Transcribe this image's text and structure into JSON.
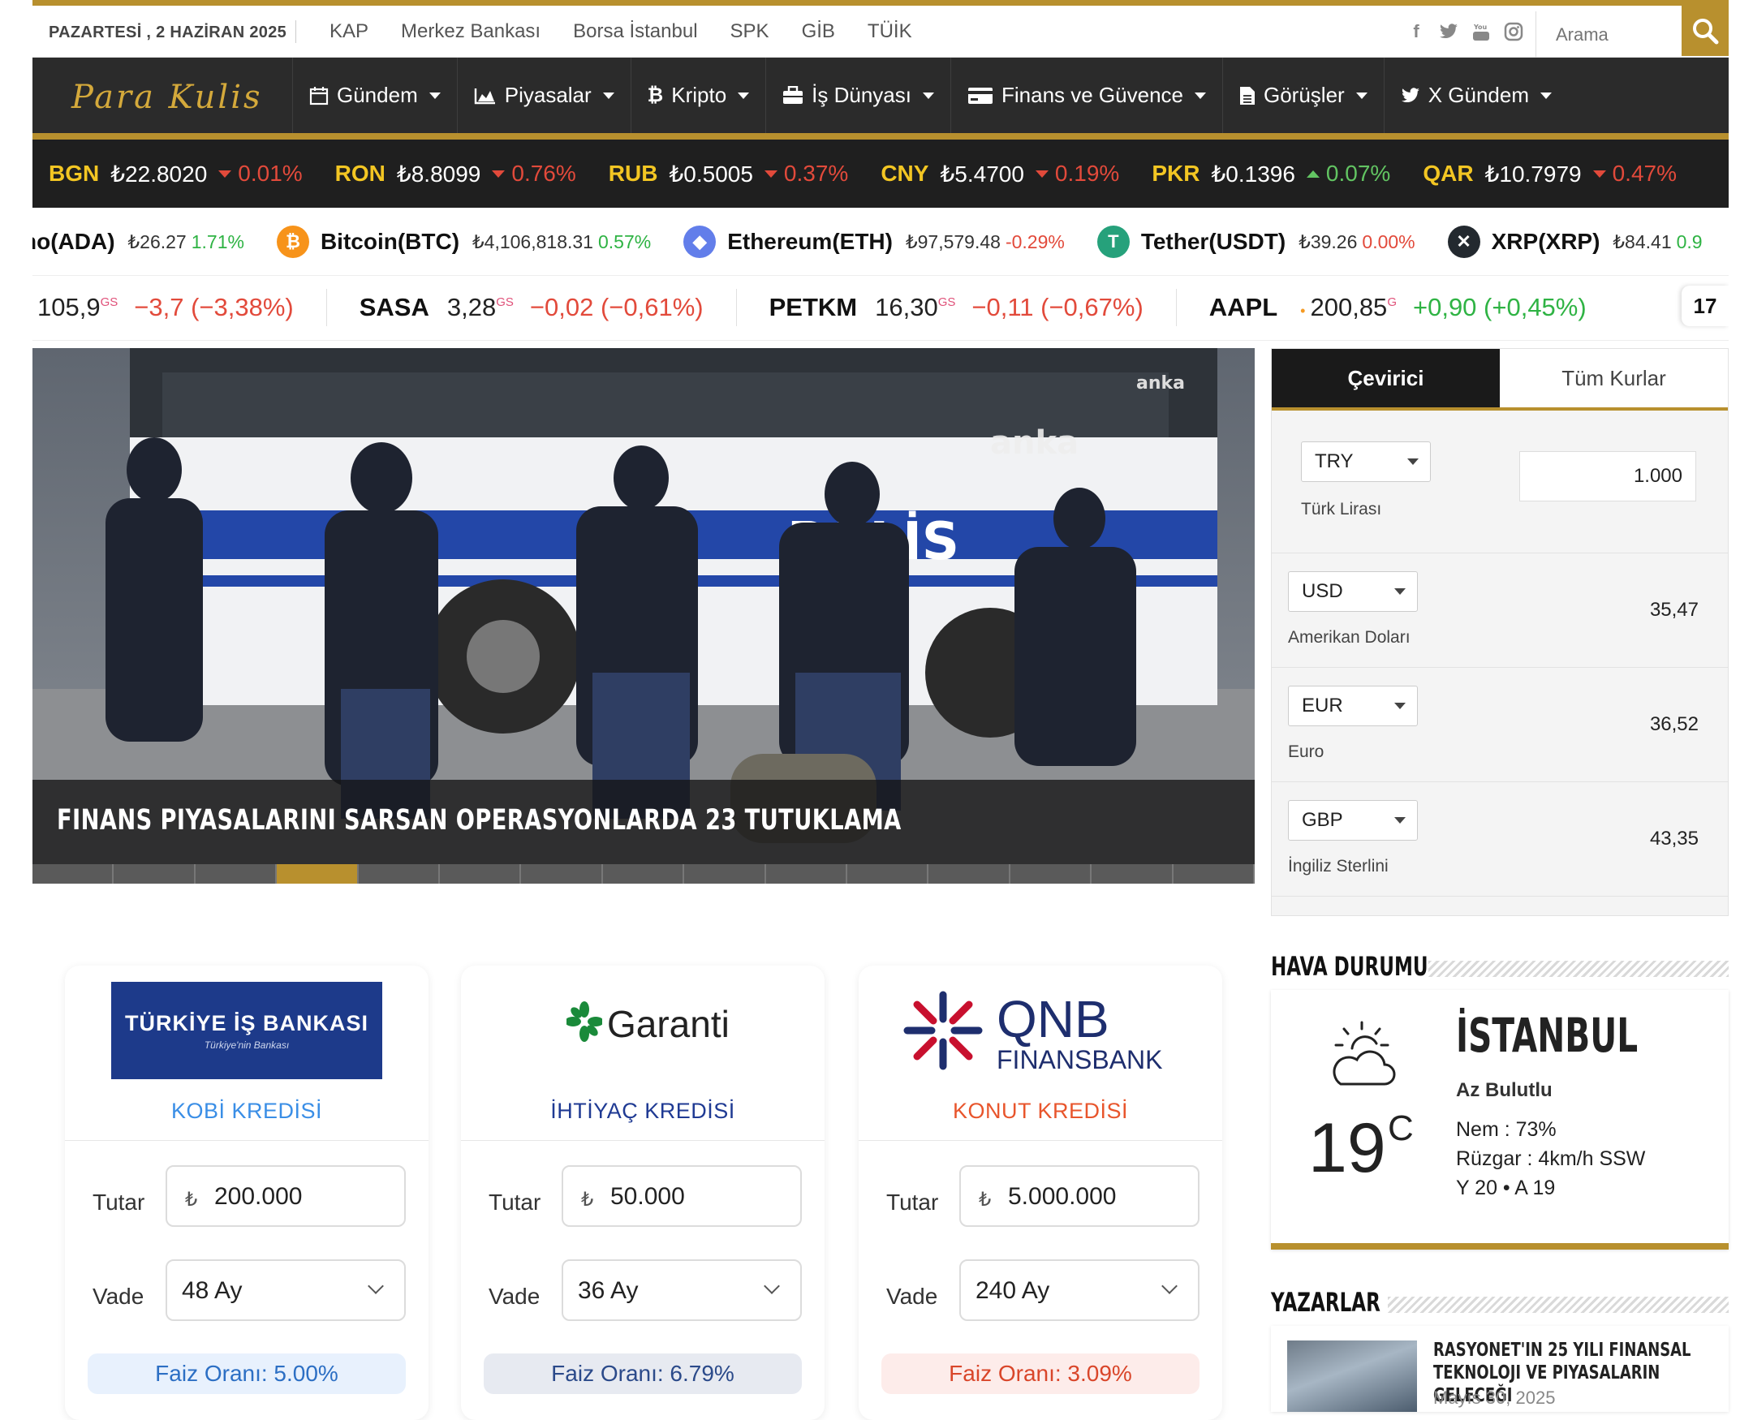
{
  "topbar": {
    "date": "PAZARTESİ , 2 HAZİRAN 2025",
    "links": [
      "KAP",
      "Merkez Bankası",
      "Borsa İstanbul",
      "SPK",
      "GİB",
      "TÜİK"
    ],
    "search_placeholder": "Arama"
  },
  "nav": {
    "logo": "Para Kulis",
    "items": [
      {
        "label": "Gündem",
        "icon": "calendar-icon"
      },
      {
        "label": "Piyasalar",
        "icon": "area-chart-icon"
      },
      {
        "label": "Kripto",
        "icon": "bitcoin-icon"
      },
      {
        "label": "İş Dünyası",
        "icon": "briefcase-icon"
      },
      {
        "label": "Finans ve Güvence",
        "icon": "credit-card-icon"
      },
      {
        "label": "Görüşler",
        "icon": "document-icon"
      },
      {
        "label": "X Gündem",
        "icon": "twitter-icon"
      }
    ]
  },
  "fx_ticker": [
    {
      "code": "BGN",
      "value": "₺22.8020",
      "change": "0.01%",
      "dir": "down"
    },
    {
      "code": "RON",
      "value": "₺8.8099",
      "change": "0.76%",
      "dir": "down"
    },
    {
      "code": "RUB",
      "value": "₺0.5005",
      "change": "0.37%",
      "dir": "down"
    },
    {
      "code": "CNY",
      "value": "₺5.4700",
      "change": "0.19%",
      "dir": "down"
    },
    {
      "code": "PKR",
      "value": "₺0.1396",
      "change": "0.07%",
      "dir": "up"
    },
    {
      "code": "QAR",
      "value": "₺10.7979",
      "change": "0.47%",
      "dir": "down"
    }
  ],
  "crypto_ticker": [
    {
      "name": "no(ADA)",
      "price": "₺26.27",
      "change": "1.71%",
      "dir": "up",
      "icon": ""
    },
    {
      "name": "Bitcoin(BTC)",
      "price": "₺4,106,818.31",
      "change": "0.57%",
      "dir": "up",
      "icon": "bitcoin-icon"
    },
    {
      "name": "Ethereum(ETH)",
      "price": "₺97,579.48",
      "change": "-0.29%",
      "dir": "down",
      "icon": "ethereum-icon"
    },
    {
      "name": "Tether(USDT)",
      "price": "₺39.26",
      "change": "0.00%",
      "dir": "down",
      "icon": "tether-icon"
    },
    {
      "name": "XRP(XRP)",
      "price": "₺84.41",
      "change": "0.9",
      "dir": "up",
      "icon": "xrp-icon"
    }
  ],
  "stock_ticker": [
    {
      "symbol": "",
      "price": "105,9",
      "sup": "GS",
      "change": "−3,7 (−3,38%)",
      "dir": "down"
    },
    {
      "symbol": "SASA",
      "price": "3,28",
      "sup": "GS",
      "change": "−0,02 (−0,61%)",
      "dir": "down"
    },
    {
      "symbol": "PETKM",
      "price": "16,30",
      "sup": "GS",
      "change": "−0,11 (−0,67%)",
      "dir": "down"
    },
    {
      "symbol": "AAPL",
      "price": "200,85",
      "sup": "G",
      "change": "+0,90 (+0,45%)",
      "dir": "up"
    }
  ],
  "hero": {
    "title": "FINANS PIYASALARINI SARSAN OPERASYONLARDA 23 TUTUKLAMA",
    "watermark_top": "anka",
    "watermark": "anka",
    "bus_text": "POLİS",
    "slides": 15,
    "active_slide": 4
  },
  "converter": {
    "tabs": [
      "Çevirici",
      "Tüm Kurlar"
    ],
    "base": {
      "code": "TRY",
      "name": "Türk Lirası",
      "amount": "1.000"
    },
    "rows": [
      {
        "code": "USD",
        "name": "Amerikan Doları",
        "value": "35,47"
      },
      {
        "code": "EUR",
        "name": "Euro",
        "value": "36,52"
      },
      {
        "code": "GBP",
        "name": "İngiliz Sterlini",
        "value": "43,35"
      }
    ]
  },
  "weather": {
    "heading": "HAVA DURUMU",
    "city": "İSTANBUL",
    "description": "Az Bulutlu",
    "humidity": "Nem : 73%",
    "wind": "Rüzgar : 4km/h SSW",
    "hilo": "Y 20 • A 19",
    "temp": "19",
    "unit": "C"
  },
  "authors": {
    "heading": "YAZARLAR",
    "items": [
      {
        "title": "RASYONET'IN 25 YILI FINANSAL TEKNOLOJI VE PIYASALARIN GELECEĞI",
        "date": "Mayıs 30, 2025"
      }
    ]
  },
  "loans": [
    {
      "bank": "TÜRKİYE İŞ BANKASI",
      "bank_sub": "Türkiye'nin Bankası",
      "type": "KOBİ KREDİSİ",
      "type_color": "#3a8ee6",
      "amount_label": "Tutar",
      "amount": "200.000",
      "term_label": "Vade",
      "term": "48 Ay",
      "rate": "Faiz Oranı: 5.00%",
      "rate_bg": "#e8f1fd",
      "rate_color": "#2c6fc4"
    },
    {
      "bank": "Garanti",
      "bank_sub": "",
      "type": "İHTİYAÇ KREDİSİ",
      "type_color": "#1f3a93",
      "amount_label": "Tutar",
      "amount": "50.000",
      "term_label": "Vade",
      "term": "36 Ay",
      "rate": "Faiz Oranı: 6.79%",
      "rate_bg": "#e7eaf1",
      "rate_color": "#2b4a8a"
    },
    {
      "bank": "QNB",
      "bank_sub": "FINANSBANK",
      "type": "KONUT KREDİSİ",
      "type_color": "#e8552c",
      "amount_label": "Tutar",
      "amount": "5.000.000",
      "term_label": "Vade",
      "term": "240 Ay",
      "rate": "Faiz Oranı: 3.09%",
      "rate_bg": "#fdecea",
      "rate_color": "#d9462a"
    }
  ],
  "currency_symbol": "₺",
  "colors": {
    "gold": "#b8902e",
    "nav": "#2b2b2b",
    "ticker": "#1f1f1f",
    "ticker_code": "#f3c623",
    "up": "#2fb344",
    "down": "#e24a3b"
  }
}
